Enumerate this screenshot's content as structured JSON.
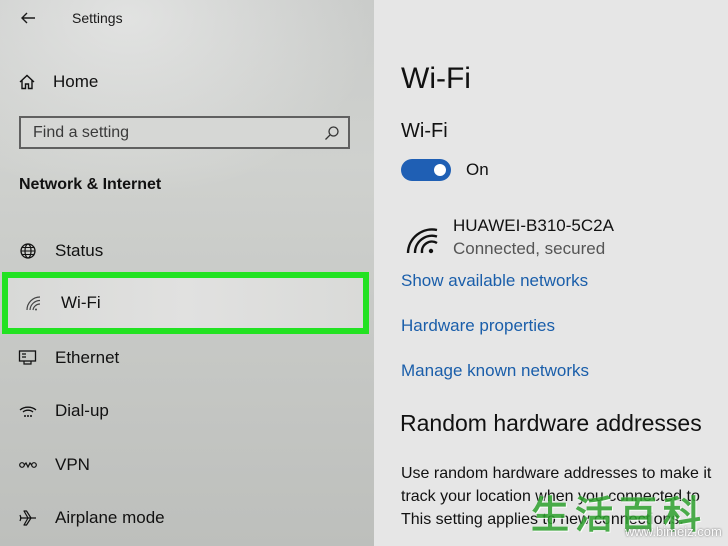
{
  "window": {
    "title": "Settings"
  },
  "sidebar": {
    "home_label": "Home",
    "search_placeholder": "Find a setting",
    "section_title": "Network & Internet",
    "items": [
      {
        "label": "Status",
        "icon": "globe-icon"
      },
      {
        "label": "Wi-Fi",
        "icon": "wifi-icon",
        "selected": true
      },
      {
        "label": "Ethernet",
        "icon": "ethernet-icon"
      },
      {
        "label": "Dial-up",
        "icon": "dialup-icon"
      },
      {
        "label": "VPN",
        "icon": "vpn-icon"
      },
      {
        "label": "Airplane mode",
        "icon": "airplane-icon"
      }
    ]
  },
  "main": {
    "title": "Wi-Fi",
    "wifi_heading": "Wi-Fi",
    "toggle_state": "On",
    "toggle_on": true,
    "network": {
      "name": "HUAWEI-B310-5C2A",
      "status": "Connected, secured"
    },
    "links": {
      "show_networks": "Show available networks",
      "hardware_properties": "Hardware properties",
      "manage_networks": "Manage known networks"
    },
    "random_heading": "Random hardware addresses",
    "description_lines": [
      "Use random hardware addresses to make it",
      "track your location when you connected to",
      "This setting applies to new connections."
    ]
  },
  "colors": {
    "accent": "#1f5fb4",
    "highlight": "#22e222",
    "link": "#1a5eaa"
  },
  "watermark": {
    "text": "生活百科",
    "url": "www.bimeiz.com"
  }
}
